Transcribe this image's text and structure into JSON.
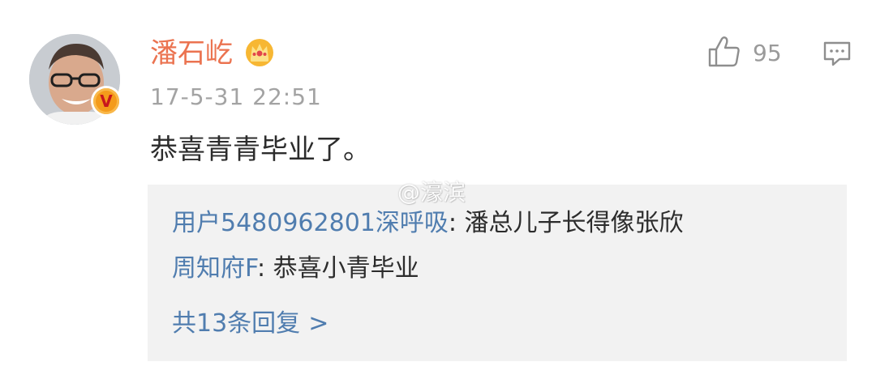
{
  "comment": {
    "username": "潘石屹",
    "timestamp": "17-5-31 22:51",
    "text": "恭喜青青毕业了。",
    "like_count": "95",
    "verified_badge": "V",
    "crown_icon": "crown-icon",
    "like_icon": "thumbs-up-icon",
    "comment_icon": "comment-icon"
  },
  "watermark": "@濠滨",
  "replies": [
    {
      "user": "用户5480962801深呼吸",
      "separator": ": ",
      "text": "潘总儿子长得像张欣"
    },
    {
      "user": "周知府F",
      "separator": ": ",
      "text": "恭喜小青毕业"
    }
  ],
  "more_replies": {
    "label": "共13条回复",
    "chevron": ">"
  },
  "colors": {
    "username": "#eb7350",
    "link_blue": "#507daf",
    "reply_bg": "#f2f2f2",
    "muted_gray": "#a3a3a3",
    "badge_orange": "#f49b1b"
  }
}
